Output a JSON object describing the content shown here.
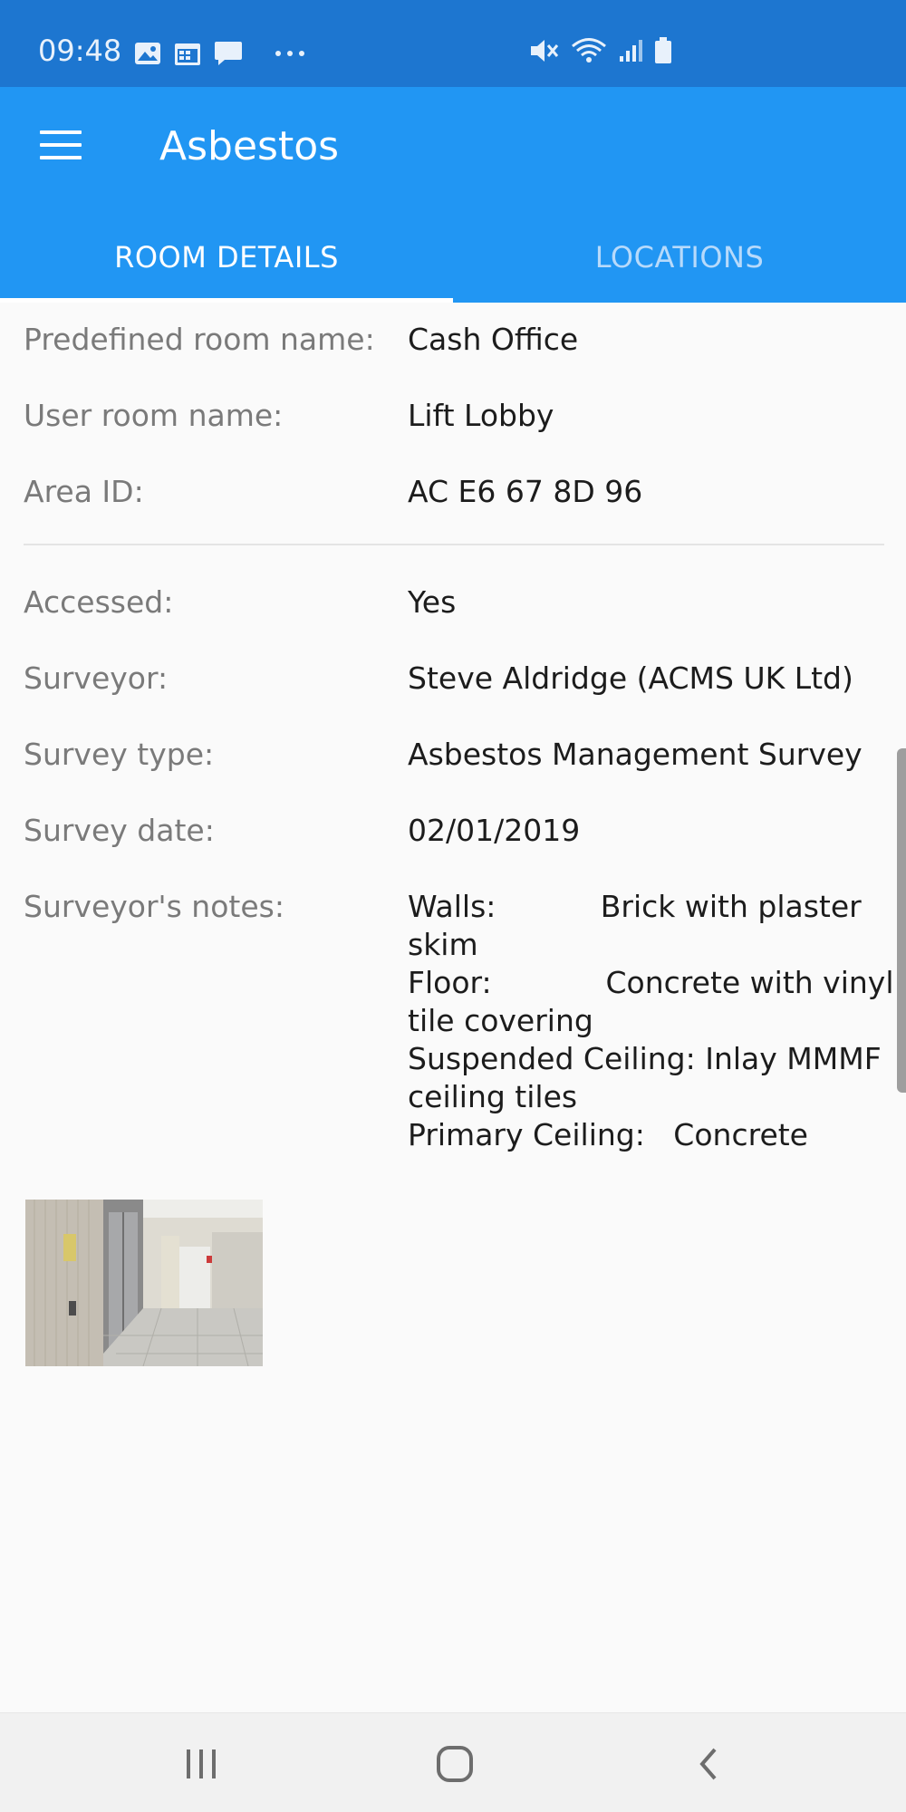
{
  "status_bar": {
    "time": "09:48",
    "left_icons": [
      "image-icon",
      "calendar-icon",
      "message-icon",
      "more-dots-icon"
    ],
    "right_icons": [
      "mute-icon",
      "wifi-icon",
      "signal-icon",
      "battery-icon"
    ]
  },
  "app_bar": {
    "title": "Asbestos",
    "menu_icon": "hamburger-menu-icon"
  },
  "tabs": [
    {
      "label": "ROOM DETAILS",
      "active": true
    },
    {
      "label": "LOCATIONS",
      "active": false
    }
  ],
  "room_details": {
    "predefined_room_name": {
      "label": "Predefined room name:",
      "value": "Cash Office"
    },
    "user_room_name": {
      "label": "User room name:",
      "value": "Lift Lobby"
    },
    "area_id": {
      "label": "Area ID:",
      "value": "AC E6 67 8D 96"
    },
    "accessed": {
      "label": "Accessed:",
      "value": "Yes"
    },
    "surveyor": {
      "label": "Surveyor:",
      "value": "Steve Aldridge (ACMS UK Ltd)"
    },
    "survey_type": {
      "label": "Survey type:",
      "value": "Asbestos Management Survey"
    },
    "survey_date": {
      "label": "Survey date:",
      "value": "02/01/2019"
    },
    "surveyors_notes": {
      "label": "Surveyor's notes:",
      "value": "Walls:           Brick with plaster\nskim\nFloor:            Concrete with vinyl\ntile covering\nSuspended Ceiling: Inlay MMMF\nceiling tiles\nPrimary Ceiling:   Concrete"
    }
  },
  "nav_bar": {
    "buttons": [
      "recent-apps-icon",
      "home-icon",
      "back-icon"
    ]
  },
  "colors": {
    "status_bar": "#1d76d0",
    "app_bar": "#2196f3",
    "background": "#fafafa",
    "label": "#7a7a7a",
    "value": "#1c1c1c"
  }
}
